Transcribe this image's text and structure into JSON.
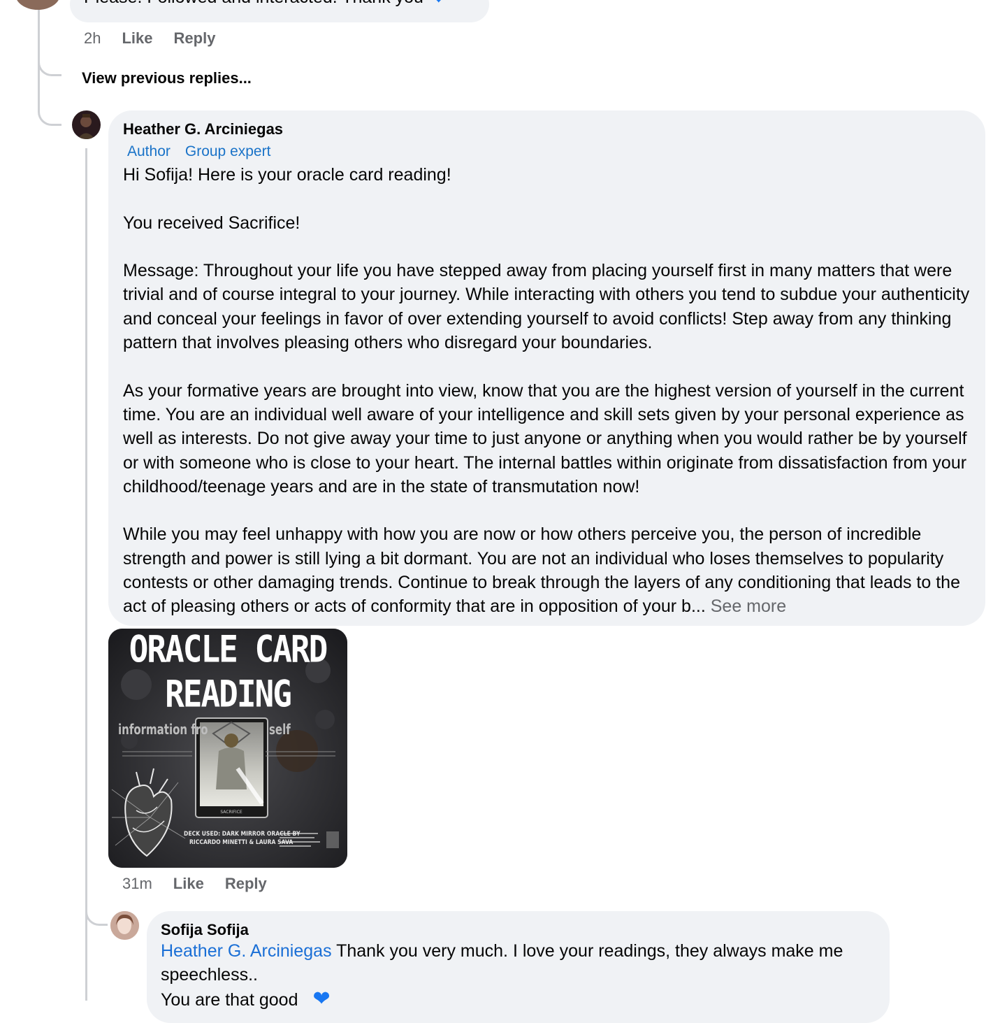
{
  "top_comment": {
    "text": "Please.  Followed and interacted. Thank you",
    "time": "2h",
    "like": "Like",
    "reply": "Reply"
  },
  "view_previous": "View previous replies...",
  "reply_main": {
    "author": "Heather G. Arciniegas",
    "badges": [
      "Author",
      "Group expert"
    ],
    "paragraphs": [
      "Hi Sofija! Here is your oracle card reading!",
      "You received Sacrifice!",
      "Message: Throughout your life you have stepped away from placing yourself first in many matters that were trivial and of course integral to your journey. While interacting with others you tend to subdue your authenticity and conceal your feelings in favor of over extending yourself to avoid conflicts! Step away from any thinking pattern that involves pleasing others who disregard your boundaries.",
      "As your formative years are brought into view, know that you are the highest version of yourself in the current time. You are an individual well aware of your intelligence and skill sets given by your personal experience as well as interests. Do not give away your time to just anyone or anything when you would rather be by yourself or with someone who is close to your heart. The internal battles within originate from dissatisfaction from your childhood/teenage years and are in the state of transmutation now!",
      "While you may feel unhappy with how you are now or how others perceive you, the person of incredible strength and power is still lying a bit dormant. You are not an individual who loses themselves to popularity contests or other damaging trends. Continue to break through the layers of any conditioning that leads to the act of pleasing others or acts of conformity that are in opposition of your b..."
    ],
    "see_more": "See more",
    "image": {
      "title_line1": "ORACLE CARD",
      "title_line2": "READING",
      "subtitle": "information fro",
      "subtitle_right": "self",
      "card_caption": "SACRIFICE",
      "deck_line1": "DECK USED: DARK MIRROR ORACLE BY",
      "deck_line2": "RICCARDO MINETTI & LAURA SAVA"
    },
    "time": "31m",
    "like": "Like",
    "reply": "Reply"
  },
  "reply_sofija": {
    "author": "Sofija Sofija",
    "mention": "Heather G. Arciniegas",
    "text": " Thank you very much. I love your readings, they always make me speechless..",
    "text2": "You are that good"
  },
  "colors": {
    "bubble": "#f0f2f5",
    "link": "#1a6fd6",
    "heart": "#1877f2",
    "meta": "#65676b"
  }
}
